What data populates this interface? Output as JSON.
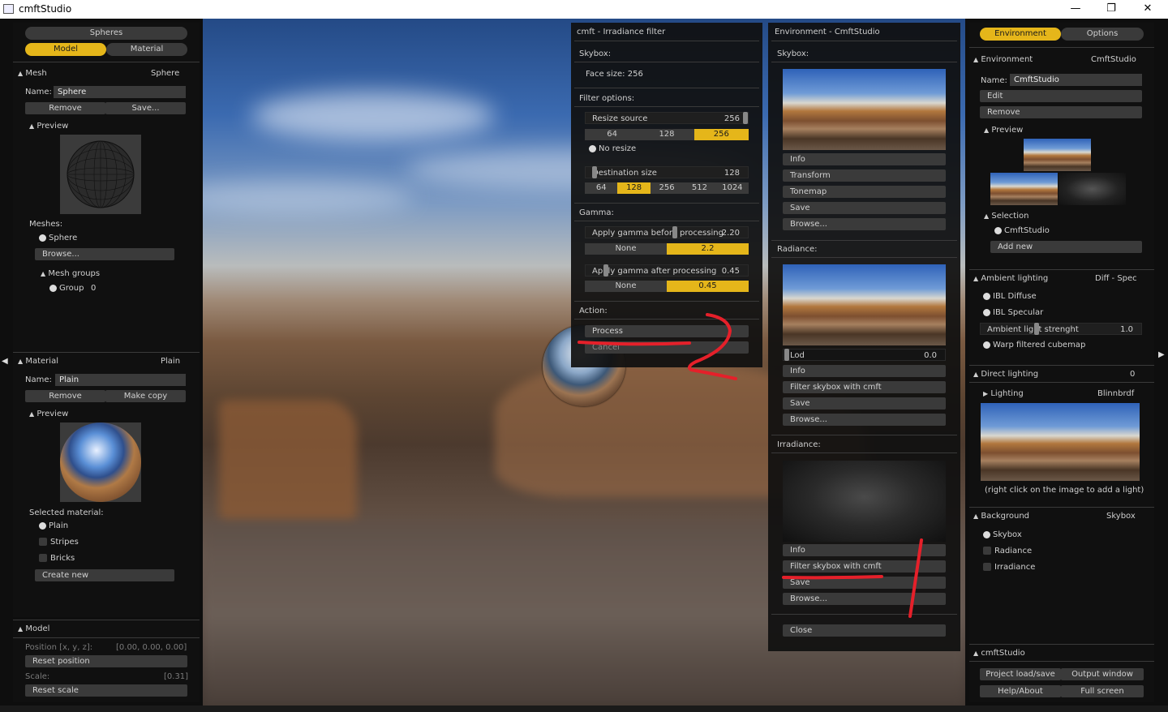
{
  "window": {
    "title": "cmftStudio",
    "minimize": "—",
    "restore": "❐",
    "close": "✕"
  },
  "left": {
    "tabs_top": {
      "spheres": "Spheres"
    },
    "tabs": {
      "model": "Model",
      "material": "Material"
    },
    "mesh": {
      "header": "Mesh",
      "value": "Sphere",
      "name_label": "Name:",
      "name": "Sphere",
      "remove": "Remove",
      "save": "Save...",
      "preview": "Preview",
      "meshes_label": "Meshes:",
      "meshes": [
        "Sphere"
      ],
      "browse": "Browse...",
      "mesh_groups": "Mesh groups",
      "group": "Group",
      "group_idx": "0"
    },
    "material": {
      "header": "Material",
      "value": "Plain",
      "name_label": "Name:",
      "name": "Plain",
      "remove": "Remove",
      "make_copy": "Make copy",
      "preview": "Preview",
      "selected_label": "Selected material:",
      "options": [
        "Plain",
        "Stripes",
        "Bricks"
      ],
      "create_new": "Create new"
    },
    "model": {
      "header": "Model",
      "position_label": "Position [x, y, z]:",
      "position_value": "[0.00,  0.00,  0.00]",
      "reset_position": "Reset position",
      "scale_label": "Scale:",
      "scale_value": "[0.31]",
      "reset_scale": "Reset scale"
    }
  },
  "irradiance_filter": {
    "title": "cmft - Irradiance filter",
    "skybox_label": "Skybox:",
    "face_size": "Face size: 256",
    "filter_options": "Filter options:",
    "resize_source": "Resize source",
    "resize_source_val": "256",
    "resize_opts": [
      "64",
      "128",
      "256"
    ],
    "no_resize": "No resize",
    "dest_size": "Destination size",
    "dest_size_val": "128",
    "dest_opts": [
      "64",
      "128",
      "256",
      "512",
      "1024"
    ],
    "gamma_label": "Gamma:",
    "gamma_before": "Apply gamma before processing",
    "gamma_before_val": "2.20",
    "gamma_before_opts": [
      "None",
      "2.2"
    ],
    "gamma_after": "Apply gamma after processing",
    "gamma_after_val": "0.45",
    "gamma_after_opts": [
      "None",
      "0.45"
    ],
    "action_label": "Action:",
    "process": "Process",
    "cancel": "Cancel"
  },
  "environment": {
    "title": "Environment - CmftStudio",
    "skybox_label": "Skybox:",
    "skybox_buttons": [
      "Info",
      "Transform",
      "Tonemap",
      "Save",
      "Browse..."
    ],
    "radiance_label": "Radiance:",
    "lod": "Lod",
    "lod_val": "0.0",
    "radiance_buttons": [
      "Info",
      "Filter skybox with cmft",
      "Save",
      "Browse..."
    ],
    "irradiance_label": "Irradiance:",
    "irradiance_buttons": [
      "Info",
      "Filter skybox with cmft",
      "Save",
      "Browse..."
    ],
    "close": "Close"
  },
  "right": {
    "tabs": {
      "environment": "Environment",
      "options": "Options"
    },
    "environment": {
      "header": "Environment",
      "value": "CmftStudio",
      "name_label": "Name:",
      "name": "CmftStudio",
      "edit": "Edit",
      "remove": "Remove",
      "preview": "Preview",
      "selection": "Selection",
      "selection_item": "CmftStudio",
      "add_new": "Add new"
    },
    "ambient": {
      "header": "Ambient lighting",
      "value": "Diff - Spec",
      "ibl_diffuse": "IBL Diffuse",
      "ibl_specular": "IBL Specular",
      "strength_label": "Ambient light strenght",
      "strength_val": "1.0",
      "warp": "Warp filtered cubemap"
    },
    "direct": {
      "header": "Direct lighting",
      "value": "0",
      "lighting": "Lighting",
      "lighting_val": "Blinnbrdf",
      "hint": "(right click on the image to add a light)"
    },
    "background": {
      "header": "Background",
      "value": "Skybox",
      "options": [
        "Skybox",
        "Radiance",
        "Irradiance"
      ]
    },
    "cmftstudio": {
      "header": "cmftStudio",
      "project": "Project load/save",
      "output": "Output window",
      "help": "Help/About",
      "fullscreen": "Full screen"
    }
  },
  "arrows": {
    "left": "◀",
    "right": "▶"
  }
}
